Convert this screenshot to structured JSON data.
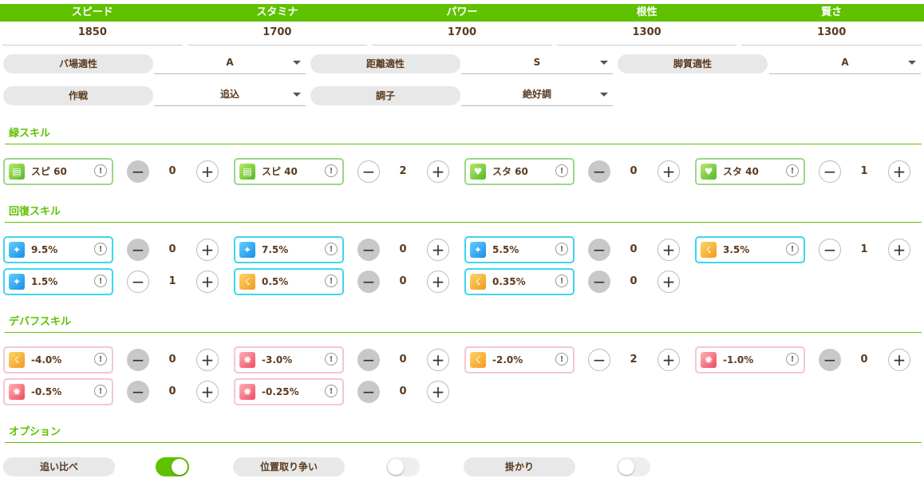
{
  "stats": {
    "headers": [
      "スピード",
      "スタミナ",
      "パワー",
      "根性",
      "賢さ"
    ],
    "values": [
      "1850",
      "1700",
      "1700",
      "1300",
      "1300"
    ]
  },
  "aptitude": {
    "baba_label": "バ場適性",
    "baba_value": "A",
    "kyori_label": "距離適性",
    "kyori_value": "S",
    "kyakushitsu_label": "脚質適性",
    "kyakushitsu_value": "A",
    "sakusen_label": "作戦",
    "sakusen_value": "追込",
    "choushi_label": "調子",
    "choushi_value": "絶好調"
  },
  "sections": {
    "green": "緑スキル",
    "recovery": "回復スキル",
    "debuff": "デバフスキル",
    "option": "オプション"
  },
  "green_skills": [
    {
      "label": "スピ 60",
      "count": "0",
      "icon": "speed-card-icon"
    },
    {
      "label": "スピ 40",
      "count": "2",
      "icon": "speed-card-icon"
    },
    {
      "label": "スタ 60",
      "count": "0",
      "icon": "heart-icon"
    },
    {
      "label": "スタ 40",
      "count": "1",
      "icon": "heart-icon"
    }
  ],
  "recovery_skills": [
    {
      "label": "9.5%",
      "count": "0",
      "icon": "sparkle-icon"
    },
    {
      "label": "7.5%",
      "count": "0",
      "icon": "sparkle-icon"
    },
    {
      "label": "5.5%",
      "count": "0",
      "icon": "sparkle-icon"
    },
    {
      "label": "3.5%",
      "count": "1",
      "icon": "runner-icon"
    },
    {
      "label": "1.5%",
      "count": "1",
      "icon": "sparkle-icon"
    },
    {
      "label": "0.5%",
      "count": "0",
      "icon": "runner-icon"
    },
    {
      "label": "0.35%",
      "count": "0",
      "icon": "runner-icon"
    }
  ],
  "debuff_skills": [
    {
      "label": "-4.0%",
      "count": "0",
      "icon": "runner-icon"
    },
    {
      "label": "-3.0%",
      "count": "0",
      "icon": "burst-icon"
    },
    {
      "label": "-2.0%",
      "count": "2",
      "icon": "runner-icon"
    },
    {
      "label": "-1.0%",
      "count": "0",
      "icon": "burst-icon"
    },
    {
      "label": "-0.5%",
      "count": "0",
      "icon": "burst-icon"
    },
    {
      "label": "-0.25%",
      "count": "0",
      "icon": "burst-icon"
    }
  ],
  "options": [
    {
      "label": "追い比べ",
      "on": true
    },
    {
      "label": "位置取り争い",
      "on": false
    },
    {
      "label": "掛かり",
      "on": false
    }
  ],
  "info_glyph": "!",
  "colors": {
    "accent": "#5fc100",
    "green_border": "#9ad78a",
    "blue_border": "#3dd6ef",
    "pink_border": "#f6c6cf"
  }
}
